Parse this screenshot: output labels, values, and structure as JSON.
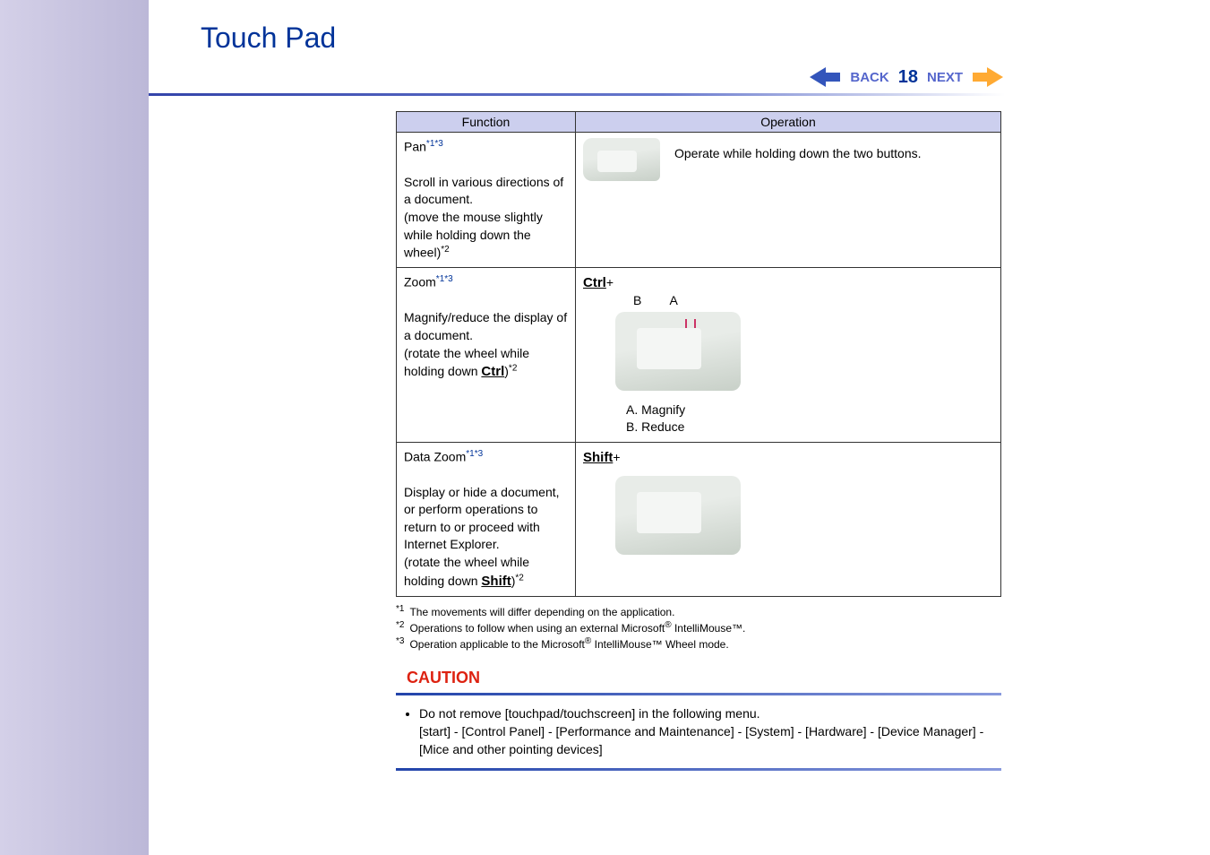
{
  "page": {
    "title": "Touch Pad",
    "back_label": "BACK",
    "page_number": "18",
    "next_label": "NEXT"
  },
  "table": {
    "headers": {
      "function": "Function",
      "operation": "Operation"
    },
    "rows": [
      {
        "func_name": "Pan",
        "func_sup": "*1*3",
        "func_desc_pre": "Scroll in various directions of a document.\n(move the mouse slightly while holding down the wheel)",
        "func_desc_sup": "*2",
        "op_text": "Operate while holding down the two buttons."
      },
      {
        "func_name": "Zoom",
        "func_sup": "*1*3",
        "func_desc_pre": "Magnify/reduce the display of a document.\n(rotate the wheel while holding down ",
        "func_key": "Ctrl",
        "func_desc_post": ")",
        "func_desc_sup": "*2",
        "op_key": "Ctrl",
        "op_plus": "+",
        "labels_ba": "B  A",
        "op_list_a": "A.  Magnify",
        "op_list_b": "B.  Reduce"
      },
      {
        "func_name": "Data Zoom",
        "func_sup": "*1*3",
        "func_desc_pre": "Display or hide a document, or perform operations to return to or proceed with Internet Explorer.\n(rotate the wheel while holding down ",
        "func_key": "Shift",
        "func_desc_post": ")",
        "func_desc_sup": "*2",
        "op_key": "Shift",
        "op_plus": "+"
      }
    ]
  },
  "footnotes": {
    "f1": {
      "num": "*1",
      "text": "The movements will differ depending on the application."
    },
    "f2": {
      "num": "*2",
      "text_a": "Operations to follow when using an external Microsoft",
      "reg": "®",
      "text_b": " IntelliMouse™."
    },
    "f3": {
      "num": "*3",
      "text_a": "Operation applicable to the Microsoft",
      "reg": "®",
      "text_c": " IntelliMouse™ Wheel mode."
    }
  },
  "caution": {
    "heading": "CAUTION",
    "line1": "Do not remove [touchpad/touchscreen] in the following menu.",
    "line2": "[start] - [Control Panel] - [Performance and Maintenance] - [System] - [Hardware] - [Device Manager] - [Mice and other pointing devices]"
  }
}
